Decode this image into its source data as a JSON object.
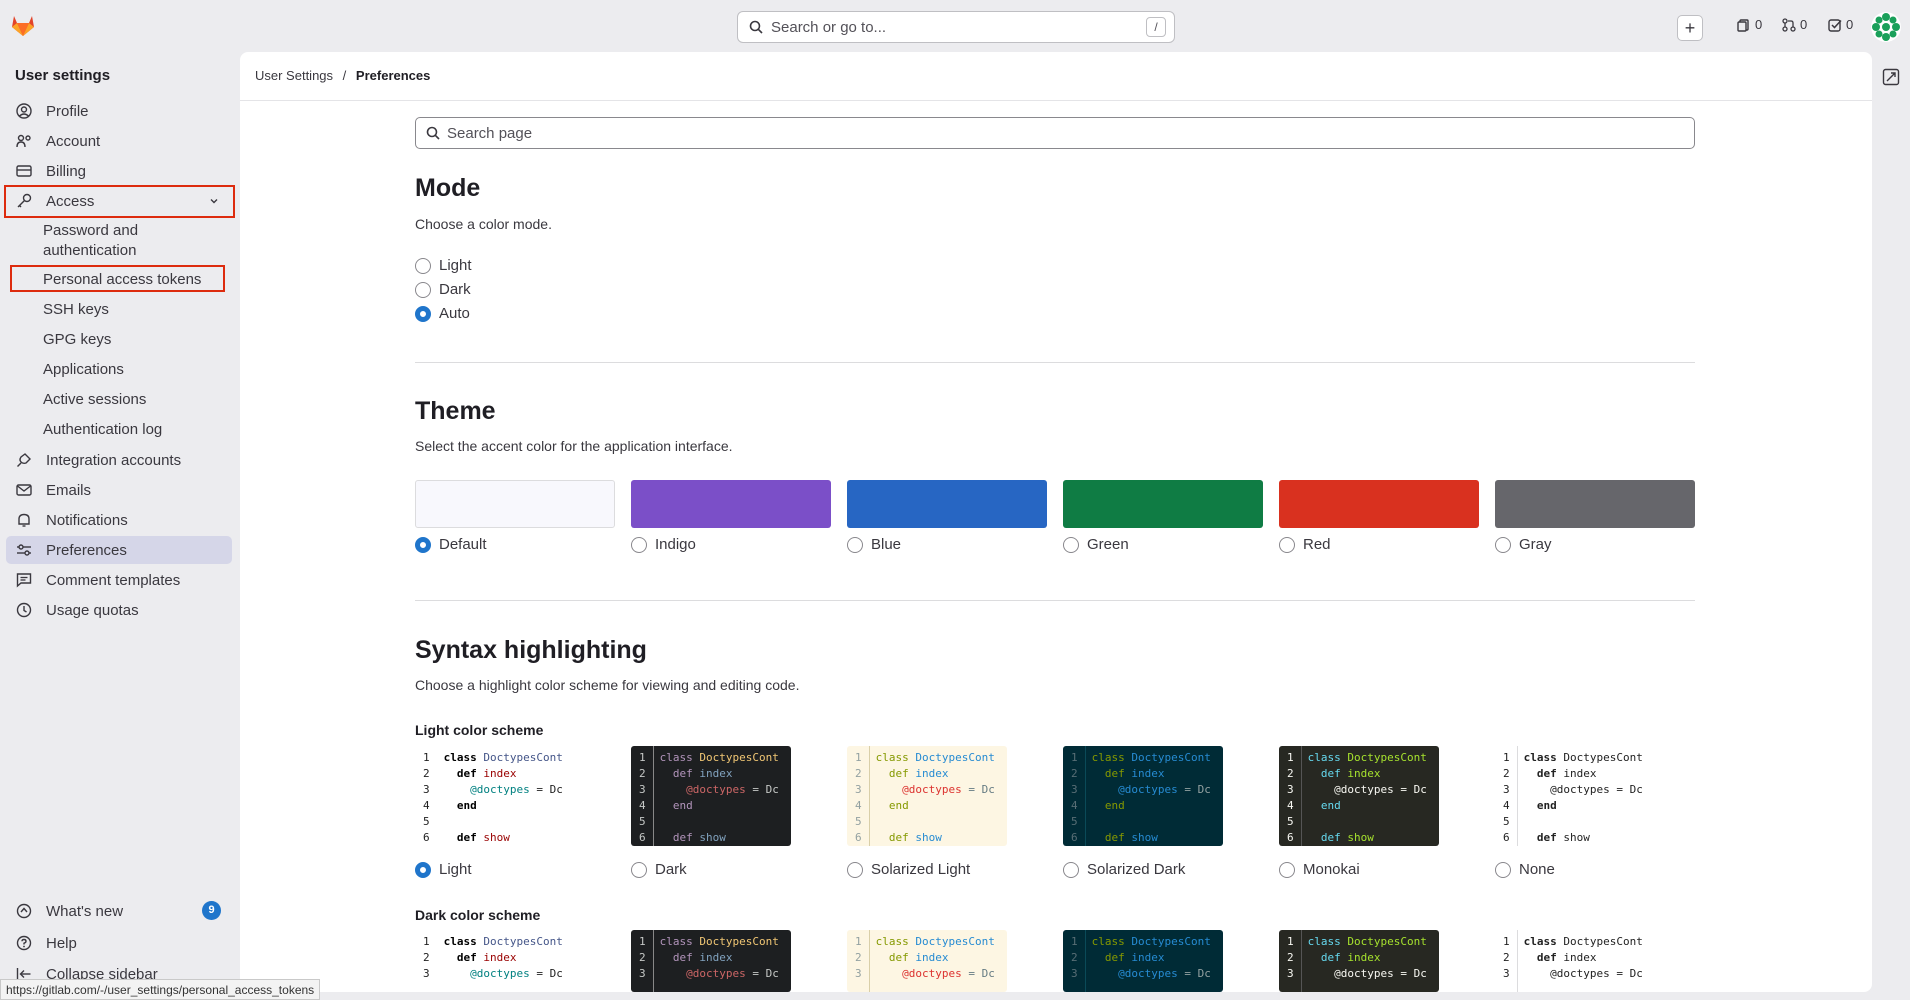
{
  "topbar": {
    "search_placeholder": "Search or go to...",
    "search_shortcut": "/",
    "issues_count": "0",
    "mr_count": "0",
    "todo_count": "0"
  },
  "sidebar": {
    "title": "User settings",
    "items": {
      "profile": "Profile",
      "account": "Account",
      "billing": "Billing",
      "access": "Access",
      "password": "Password and authentication",
      "pat": "Personal access tokens",
      "ssh": "SSH keys",
      "gpg": "GPG keys",
      "applications": "Applications",
      "sessions": "Active sessions",
      "authlog": "Authentication log",
      "integrations": "Integration accounts",
      "emails": "Emails",
      "notifications": "Notifications",
      "preferences": "Preferences",
      "comment_templates": "Comment templates",
      "usage_quotas": "Usage quotas"
    },
    "whats_new": "What's new",
    "whats_new_badge": "9",
    "help": "Help",
    "collapse": "Collapse sidebar"
  },
  "breadcrumb": {
    "parent": "User Settings",
    "sep": "/",
    "current": "Preferences"
  },
  "search_page_placeholder": "Search page",
  "mode": {
    "title": "Mode",
    "desc": "Choose a color mode.",
    "options": [
      "Light",
      "Dark",
      "Auto"
    ],
    "selected": "Auto"
  },
  "theme": {
    "title": "Theme",
    "desc": "Select the accent color for the application interface.",
    "options": [
      {
        "label": "Default",
        "color": "#f8f8fd"
      },
      {
        "label": "Indigo",
        "color": "#7b4fc8"
      },
      {
        "label": "Blue",
        "color": "#2766c3"
      },
      {
        "label": "Green",
        "color": "#0f7c44"
      },
      {
        "label": "Red",
        "color": "#d9311f"
      },
      {
        "label": "Gray",
        "color": "#66666b"
      }
    ],
    "selected": "Default"
  },
  "syntax": {
    "title": "Syntax highlighting",
    "desc": "Choose a highlight color scheme for viewing and editing code.",
    "light_heading": "Light color scheme",
    "dark_heading": "Dark color scheme",
    "schemes": [
      "Light",
      "Dark",
      "Solarized Light",
      "Solarized Dark",
      "Monokai",
      "None"
    ],
    "selected": "Light",
    "code_lines": [
      "class DoctypesCont",
      "  def index",
      "    @doctypes = Dc",
      "  end",
      "",
      "  def show"
    ]
  },
  "status_url": "https://gitlab.com/-/user_settings/personal_access_tokens"
}
